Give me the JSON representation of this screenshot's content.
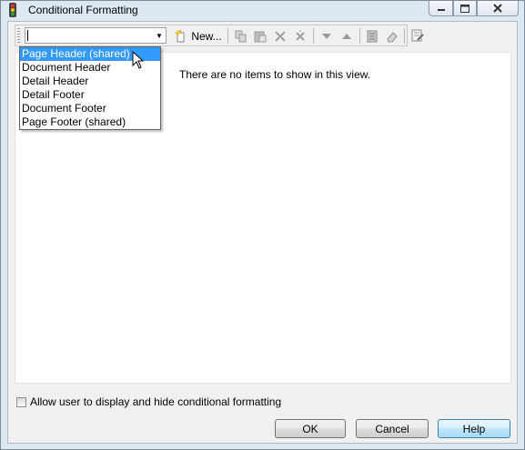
{
  "window": {
    "title": "Conditional Formatting",
    "icon": "traffic-light-icon"
  },
  "toolbar": {
    "combo_value": "",
    "new_label": "New...",
    "icons": [
      "new-icon",
      "copy-icon",
      "paste-icon",
      "delete-icon",
      "delete-all-icon",
      "move-down-icon",
      "move-up-icon",
      "formula-icon",
      "eraser-icon",
      "properties-icon"
    ]
  },
  "dropdown": {
    "items": [
      "Page Header (shared)",
      "Document Header",
      "Detail Header",
      "Detail Footer",
      "Document Footer",
      "Page Footer (shared)"
    ],
    "selected_index": 0
  },
  "content": {
    "empty_message": "There are no items to show in this view."
  },
  "options": {
    "allow_toggle_label": "Allow user to display and hide conditional formatting",
    "allow_toggle_checked": false
  },
  "buttons": {
    "ok": "OK",
    "cancel": "Cancel",
    "help": "Help"
  },
  "colors": {
    "selection": "#3399ff",
    "window_frame": "#dde8f3",
    "client_bg": "#f0f0f0"
  }
}
